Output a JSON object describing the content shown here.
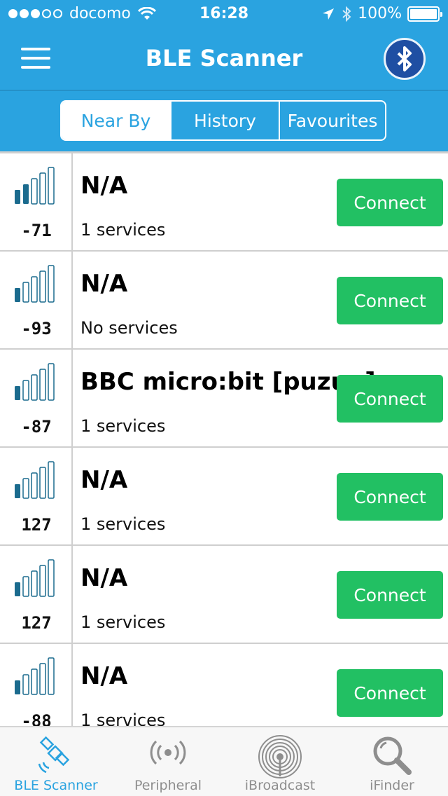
{
  "status_bar": {
    "carrier": "docomo",
    "time": "16:28",
    "battery": "100%",
    "signal_dots": [
      true,
      true,
      true,
      false,
      false
    ]
  },
  "navbar": {
    "title": "BLE Scanner"
  },
  "segments": [
    {
      "label": "Near By",
      "active": true
    },
    {
      "label": "History",
      "active": false
    },
    {
      "label": "Favourites",
      "active": false
    }
  ],
  "devices": [
    {
      "name": "N/A",
      "services": "1 services",
      "rssi": "-71",
      "signal_level": 2,
      "connect_label": "Connect"
    },
    {
      "name": "N/A",
      "services": "No services",
      "rssi": "-93",
      "signal_level": 1,
      "connect_label": "Connect"
    },
    {
      "name": "BBC micro:bit [puzup]",
      "services": "1 services",
      "rssi": "-87",
      "signal_level": 1,
      "connect_label": "Connect"
    },
    {
      "name": "N/A",
      "services": "1 services",
      "rssi": "127",
      "signal_level": 1,
      "connect_label": "Connect"
    },
    {
      "name": "N/A",
      "services": "1 services",
      "rssi": "127",
      "signal_level": 1,
      "connect_label": "Connect"
    },
    {
      "name": "N/A",
      "services": "1 services",
      "rssi": "-88",
      "signal_level": 1,
      "connect_label": "Connect"
    }
  ],
  "tabbar": {
    "tabs": [
      {
        "label": "BLE Scanner",
        "icon": "satellite-icon",
        "active": true
      },
      {
        "label": "Peripheral",
        "icon": "broadcast-icon",
        "active": false
      },
      {
        "label": "iBroadcast",
        "icon": "target-icon",
        "active": false
      },
      {
        "label": "iFinder",
        "icon": "magnifier-icon",
        "active": false
      }
    ]
  },
  "colors": {
    "header": "#2aa3e0",
    "connect": "#22c063",
    "signal_filled": "#1b6b8e",
    "bluetooth_button": "#1f4fa3"
  }
}
